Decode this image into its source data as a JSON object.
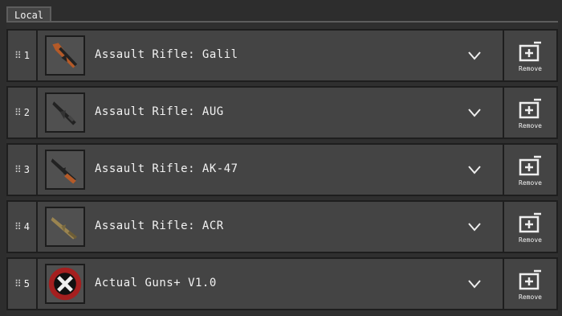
{
  "tab": {
    "label": "Local"
  },
  "rows": [
    {
      "index": "1",
      "title": "Assault Rifle: Galil",
      "icon": "rifle-galil-icon",
      "remove": "Remove"
    },
    {
      "index": "2",
      "title": "Assault Rifle: AUG",
      "icon": "rifle-aug-icon",
      "remove": "Remove"
    },
    {
      "index": "3",
      "title": "Assault Rifle: AK-47",
      "icon": "rifle-ak47-icon",
      "remove": "Remove"
    },
    {
      "index": "4",
      "title": "Assault Rifle: ACR",
      "icon": "rifle-acr-icon",
      "remove": "Remove"
    },
    {
      "index": "5",
      "title": "Actual Guns+ V1.0",
      "icon": "actual-guns-logo-icon",
      "remove": "Remove"
    }
  ]
}
